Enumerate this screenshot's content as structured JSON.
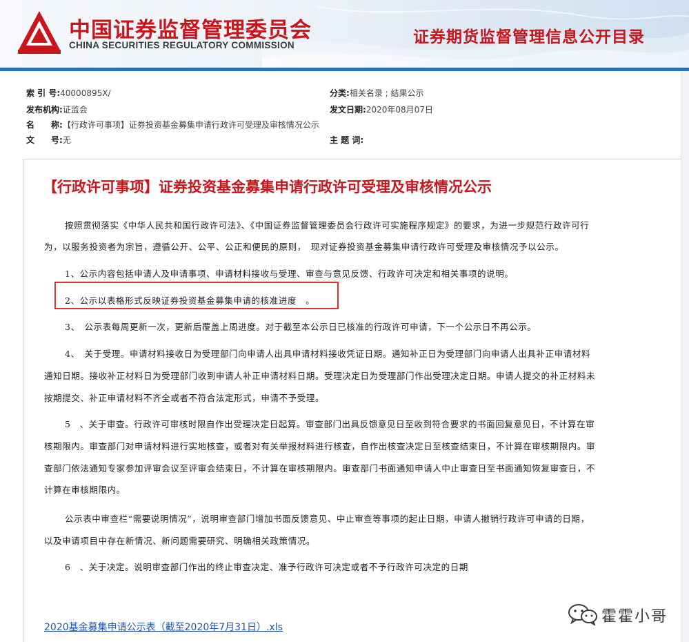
{
  "header": {
    "org_name_cn": "中国证券监督管理委员会",
    "org_name_en": "CHINA SECURITIES REGULATORY COMMISSION",
    "catalog_title": "证券期货监督管理信息公开目录",
    "brand_red": "#c8161d",
    "brand_blue": "#2a6fb8"
  },
  "meta": {
    "index_label": "索 引 号:",
    "index_value": "40000895X/",
    "category_label": "分类:",
    "category_value": "相关名录 ; 结果公示",
    "publisher_label": "发布机构:",
    "publisher_value": "证监会",
    "date_label": "发文日期:",
    "date_value": "2020年08月07日",
    "name_label": "名　　称:",
    "name_value": "【行政许可事项】证券投资基金募集申请行政许可受理及审核情况公示",
    "docno_label": "文　　号:",
    "docno_value": "无",
    "subject_label": "主 题 词:",
    "subject_value": ""
  },
  "document": {
    "title": "【行政许可事项】证券投资基金募集申请行政许可受理及审核情况公示",
    "lines": [
      "按照贯彻落实《中华人民共和国行政许可法》、《中国证券监督管理委员会行政许可实施程序规定》的要求，为进一步规范行政许可行",
      "为，以服务投资者为宗旨，遵循公开、公平、公正和便民的原则，　现对证券投资基金募集申请行政许可受理及审核情况予以公示。",
      "1、公示内容包括申请人及申请事项、申请材料接收与受理、审查与意见反馈、行政许可决定和相关事项的说明。",
      "2、公示以表格形式反映证券投资基金募集申请的核准进度　。",
      "3、　公示表每周更新一次，更新后覆盖上周进度。对于截至本公示日已核准的行政许可申请，下一个公示日不再公示。",
      "4、　关于受理。申请材料接收日为受理部门向申请人出具申请材料接收凭证日期。通知补正日为受理部门向申请人出具补正申请材料",
      "通知日期。接收补正材料日为受理部门收到申请人补正申请材料日期。受理决定日为受理部门作出受理决定日期。申请人提交的补正材料未",
      "按期提交、补正申请材料不齐全或者不符合法定形式，申请不予受理。",
      "5　、关于审查。行政许可审核时限自作出受理决定日起算。审查部门出具反馈意见日至收到符合要求的书面回复意见日，不计算在审",
      "核期限内。审查部门对申请材料进行实地核查，或者对有关举报材料进行核查，自作出核查决定日至核查结束日，不计算在审核期限内。审",
      "查部门依法通知专家参加评审会议至评审会结束日，不计算在审核期限内。审查部门书面通知申请人中止审查日至书面通知恢复审查日，不",
      "计算在审核期限内。",
      "公示表中审查栏“需要说明情况”，说明审查部门增加书面反馈意见、中止审查等事项的起止日期，申请人撤销行政许可申请的日期，",
      "以及申请项目中存在新情况、新问题需要研究、明确相关政策情况。",
      "6　、关于决定。说明审查部门作出的终止审查决定、准予行政许可决定或者不予行政许可决定的日期"
    ],
    "attachment_link": "2020基金募集申请公示表（截至2020年7月31日）.xls"
  },
  "watermark": {
    "icon": "wechat-icon",
    "text": "霍霍小哥"
  }
}
